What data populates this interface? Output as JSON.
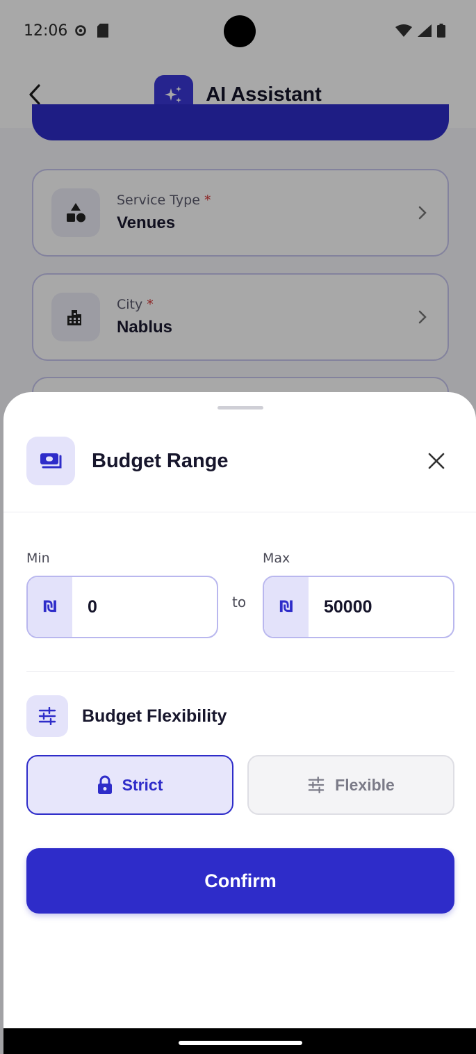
{
  "status_bar": {
    "time": "12:06"
  },
  "app_bar": {
    "title": "AI Assistant"
  },
  "background_form": {
    "fields": [
      {
        "label": "Service Type",
        "required_mark": "*",
        "value": "Venues",
        "icon": "shapes-icon"
      },
      {
        "label": "City",
        "required_mark": "*",
        "value": "Nablus",
        "icon": "city-icon"
      }
    ]
  },
  "sheet": {
    "title": "Budget Range",
    "icon": "money-icon",
    "min": {
      "label": "Min",
      "currency_symbol": "₪",
      "value": "0"
    },
    "separator": "to",
    "max": {
      "label": "Max",
      "currency_symbol": "₪",
      "value": "50000"
    },
    "flexibility": {
      "title": "Budget Flexibility",
      "options": [
        {
          "label": "Strict",
          "icon": "lock-icon",
          "selected": true
        },
        {
          "label": "Flexible",
          "icon": "sliders-icon",
          "selected": false
        }
      ]
    },
    "confirm_label": "Confirm"
  },
  "colors": {
    "primary": "#2e2cc9",
    "primary_light": "#e4e3fa",
    "required": "#d63a3a"
  }
}
